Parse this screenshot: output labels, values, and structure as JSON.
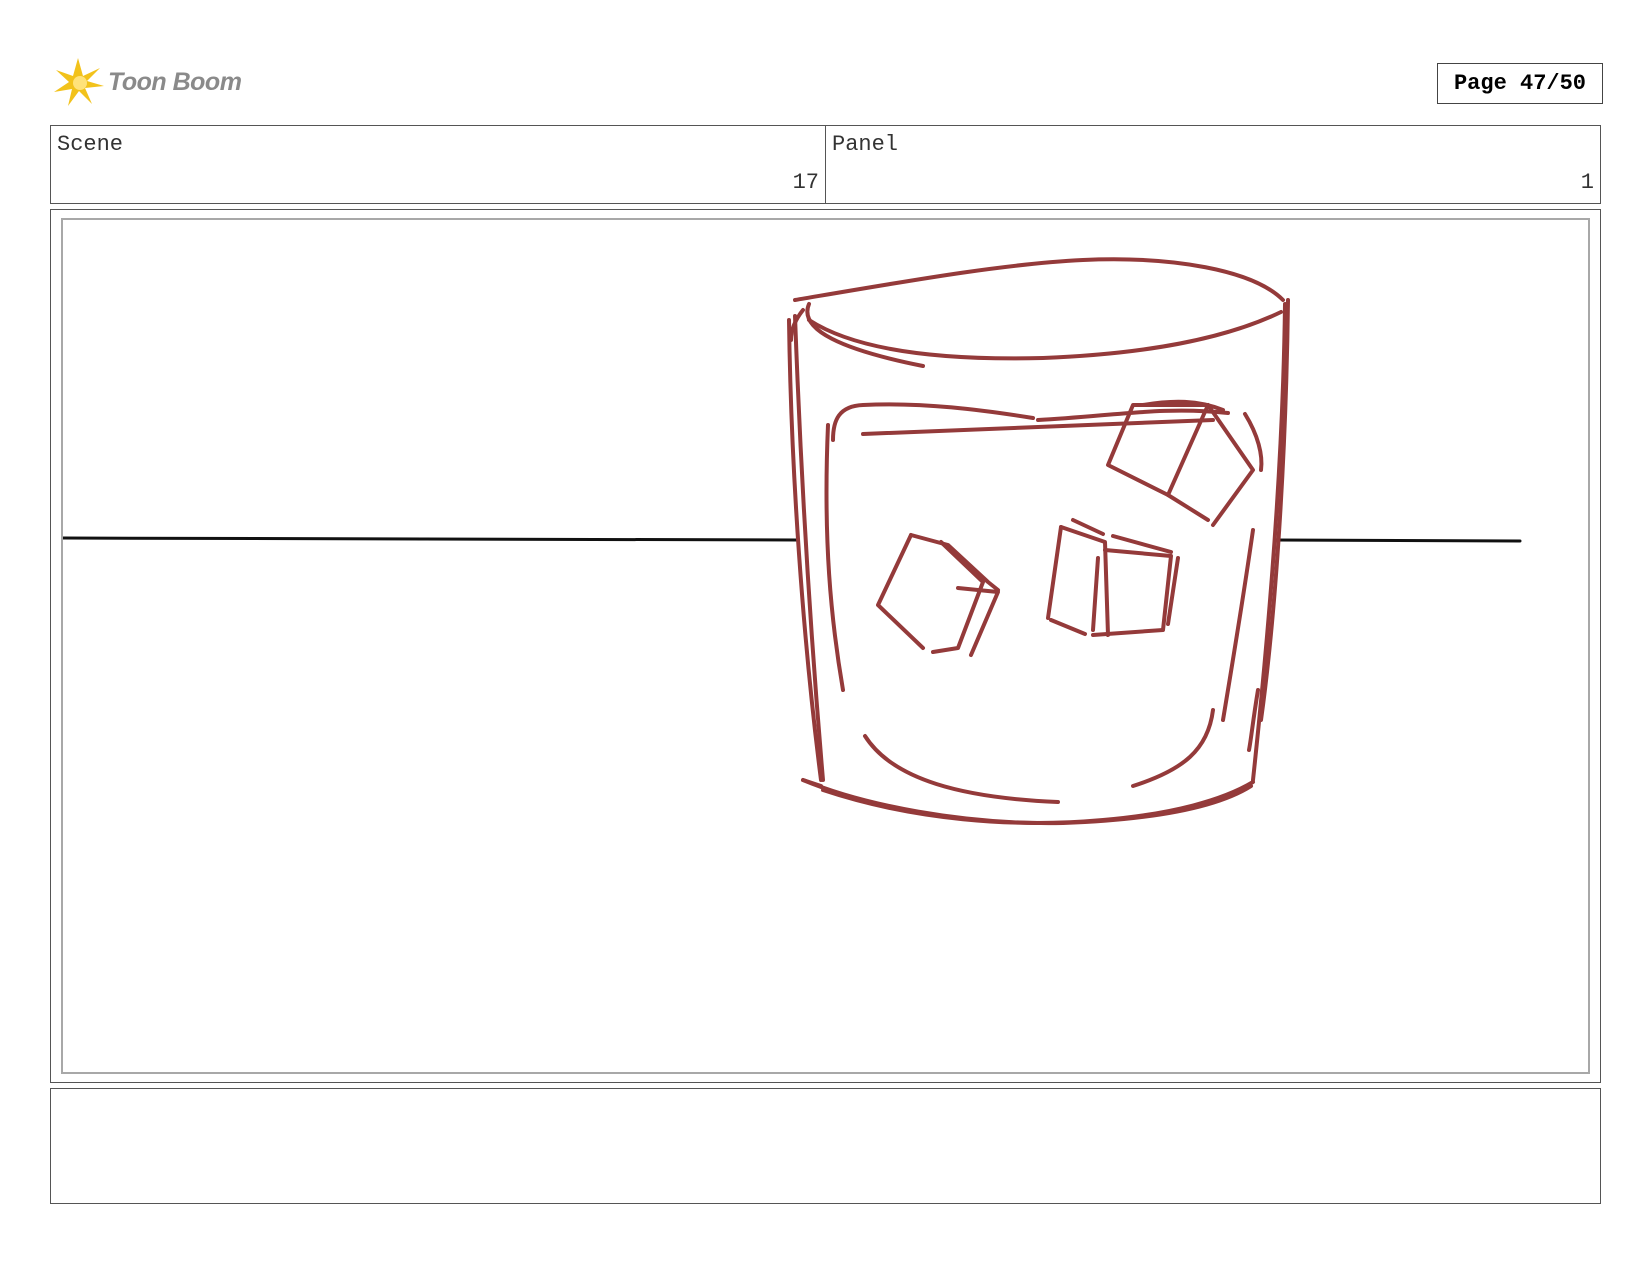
{
  "header": {
    "logo_text": "Toon Boom",
    "page_label": "Page 47/50"
  },
  "info": {
    "scene_label": "Scene",
    "scene_value": "17",
    "panel_label": "Panel",
    "panel_value": "1"
  },
  "drawing": {
    "stroke_color": "#943a3a",
    "horizon_color": "#111111",
    "subject": "glass-with-ice-icon"
  },
  "notes": {
    "text": ""
  }
}
